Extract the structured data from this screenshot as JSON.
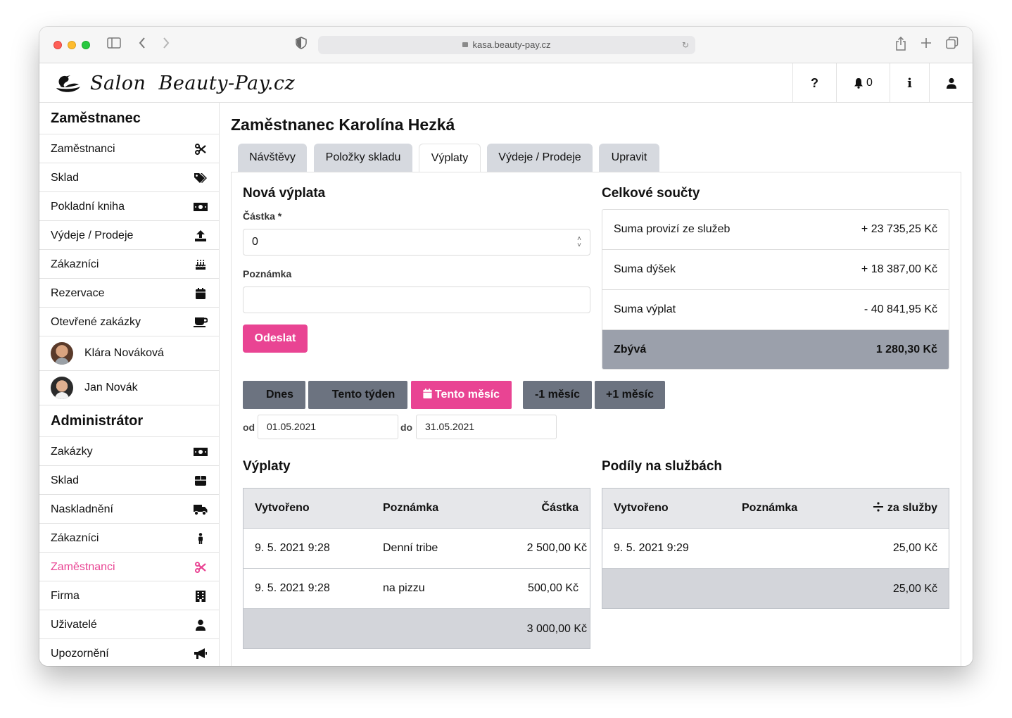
{
  "browser": {
    "url": "kasa.beauty-pay.cz"
  },
  "header": {
    "logo_text": "Salon  Beauty-Pay.cz",
    "help_label": "?",
    "notifications_count": "0",
    "info_label": "i"
  },
  "sidebar": {
    "section_employee": "Zaměstnanec",
    "employee_items": [
      {
        "label": "Zaměstnanci",
        "icon": "scissors-icon"
      },
      {
        "label": "Sklad",
        "icon": "tags-icon"
      },
      {
        "label": "Pokladní kniha",
        "icon": "money-bill-icon"
      },
      {
        "label": "Výdeje / Prodeje",
        "icon": "upload-icon"
      },
      {
        "label": "Zákazníci",
        "icon": "birthday-cake-icon"
      },
      {
        "label": "Rezervace",
        "icon": "calendar-icon"
      },
      {
        "label": "Otevřené zakázky",
        "icon": "coffee-icon"
      }
    ],
    "users": [
      {
        "name": "Klára Nováková"
      },
      {
        "name": "Jan Novák"
      }
    ],
    "section_admin": "Administrátor",
    "admin_items": [
      {
        "label": "Zakázky",
        "icon": "money-bill-icon"
      },
      {
        "label": "Sklad",
        "icon": "box-icon"
      },
      {
        "label": "Naskladnění",
        "icon": "truck-icon"
      },
      {
        "label": "Zákazníci",
        "icon": "person-icon"
      },
      {
        "label": "Zaměstnanci",
        "icon": "scissors-icon",
        "active": true
      },
      {
        "label": "Firma",
        "icon": "building-icon"
      },
      {
        "label": "Uživatelé",
        "icon": "user-icon"
      },
      {
        "label": "Upozornění",
        "icon": "megaphone-icon"
      }
    ],
    "active_color": "#e94493"
  },
  "main": {
    "title": "Zaměstnanec Karolína Hezká",
    "tabs": [
      {
        "label": "Návštěvy"
      },
      {
        "label": "Položky skladu"
      },
      {
        "label": "Výplaty",
        "active": true
      },
      {
        "label": "Výdeje / Prodeje"
      },
      {
        "label": "Upravit"
      }
    ],
    "form": {
      "title": "Nová výplata",
      "amount_label": "Částka *",
      "amount_value": "0",
      "note_label": "Poznámka",
      "note_value": "",
      "submit_label": "Odeslat"
    },
    "totals": {
      "title": "Celkové součty",
      "rows": [
        {
          "label": "Suma provizí ze služeb",
          "value": "+ 23 735,25 Kč"
        },
        {
          "label": "Suma dýšek",
          "value": "+ 18 387,00 Kč"
        },
        {
          "label": "Suma výplat",
          "value": "- 40 841,95 Kč"
        }
      ],
      "remaining_label": "Zbývá",
      "remaining_value": "1 280,30 Kč"
    },
    "period": {
      "today": "Dnes",
      "this_week": "Tento týden",
      "this_month": "Tento měsíc",
      "minus_month": "-1 měsíc",
      "plus_month": "+1 měsíc",
      "from_label": "od",
      "from_value": "01.05.2021",
      "to_label": "do",
      "to_value": "31.05.2021"
    },
    "payouts": {
      "title": "Výplaty",
      "headers": [
        "Vytvořeno",
        "Poznámka",
        "Částka"
      ],
      "rows": [
        {
          "created": "9. 5. 2021 9:28",
          "note": "Denní tribe",
          "amount": "2 500,00 Kč"
        },
        {
          "created": "9. 5. 2021 9:28",
          "note": "na pizzu",
          "amount": "500,00 Kč"
        }
      ],
      "total": "3 000,00 Kč"
    },
    "shares": {
      "title": "Podíly na službách",
      "headers": [
        "Vytvořeno",
        "Poznámka",
        "za služby"
      ],
      "rows": [
        {
          "created": "9. 5. 2021 9:29",
          "note": "",
          "amount": "25,00 Kč"
        }
      ],
      "total": "25,00 Kč"
    }
  }
}
